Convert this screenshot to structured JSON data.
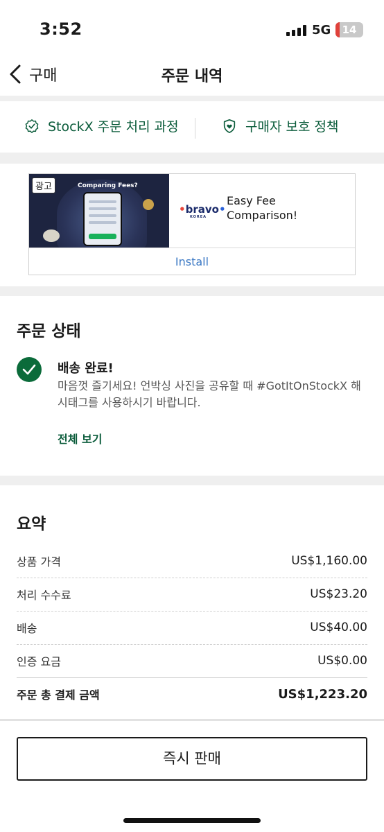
{
  "status_bar": {
    "time": "3:52",
    "network": "5G",
    "battery": "14"
  },
  "nav": {
    "back_label": "구매",
    "title": "주문 내역"
  },
  "links": {
    "process": "StockX 주문 처리 과정",
    "protection": "구매자 보호 정책"
  },
  "ad": {
    "tag": "광고",
    "image_caption": "Comparing Fees?",
    "brand": "bravo",
    "brand_sub": "KOREA",
    "title": "Easy Fee Comparison!",
    "install": "Install"
  },
  "order_status": {
    "heading": "주문 상태",
    "status": "배송 완료!",
    "description": "마음껏 즐기세요! 언박싱 사진을 공유할 때 #GotItOnStockX 해시태그를 사용하시기 바랍니다.",
    "view_all": "전체 보기"
  },
  "summary": {
    "heading": "요약",
    "rows": [
      {
        "label": "상품 가격",
        "value": "US$1,160.00"
      },
      {
        "label": "처리 수수료",
        "value": "US$23.20"
      },
      {
        "label": "배송",
        "value": "US$40.00"
      },
      {
        "label": "인증 요금",
        "value": "US$0.00"
      }
    ],
    "total": {
      "label": "주문 총 결제 금액",
      "value": "US$1,223.20"
    }
  },
  "actions": {
    "sell_now": "즉시 판매"
  },
  "colors": {
    "brand_green": "#0b5c3b",
    "check_green": "#0b6b3a",
    "link_blue": "#3b78c4",
    "band_gray": "#efefef"
  }
}
